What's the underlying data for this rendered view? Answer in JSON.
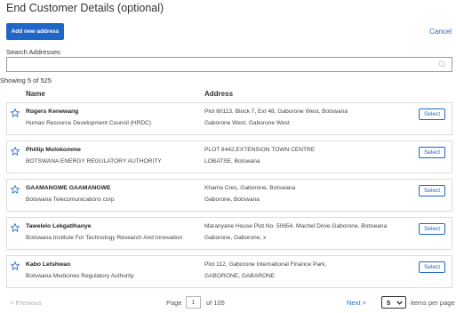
{
  "header": {
    "title": "End Customer Details (optional)",
    "add_label": "Add new address",
    "cancel_label": "Cancel"
  },
  "search": {
    "label": "Search Addresses",
    "value": "",
    "placeholder": ""
  },
  "showing_text": "Showing 5 of 525",
  "columns": {
    "name": "Name",
    "address": "Address"
  },
  "rows": [
    {
      "name": "Rogers Kenewang",
      "org": "Human Resource Development Council (HRDC)",
      "addr1": "Plot 60113, Block 7, Ext 48, Gaborone West, Botswana",
      "addr2": "Gaborone West, Gaborone West",
      "select": "Select"
    },
    {
      "name": "Phillip Molokomme",
      "org": "BOTSWANA ENERGY REGULATORY AUTHORITY",
      "addr1": "PLOT 8442,EXTENSION TOWN CENTRE",
      "addr2": "LOBATSE, Botswana",
      "select": "Select"
    },
    {
      "name": "GAAMANGWE GAAMANGWE",
      "org": "Botswana Telecomunications corp",
      "addr1": "Khama Cres, Gaborone, Botswana",
      "addr2": "Gaborone, Botswana",
      "select": "Select"
    },
    {
      "name": "Tawelelo Lekgatlhanye",
      "org": "Botswana Institute For Technology Research And Innovation",
      "addr1": "Maranyane House Plot No. 50654, Machel Drive Gaborone, Botswana",
      "addr2": "Gaborone, Gaborone, x",
      "select": "Select"
    },
    {
      "name": "Kabo Letshwao",
      "org": "Botswana Medicines Regulatory Authority",
      "addr1": "Plot 112, Gaborone International Finance Park,",
      "addr2": "GABORONE, GABARONE",
      "select": "Select"
    }
  ],
  "pagination": {
    "previous": "< Previous",
    "page_label": "Page",
    "current_page": "1",
    "of_total": "of 105",
    "next": "Next >",
    "per_page_value": "5",
    "per_page_label": "items per page"
  },
  "colors": {
    "accent": "#1f66c6",
    "border": "#dcdcdc"
  },
  "icons": {
    "star": "star-outline-icon",
    "search": "search-icon",
    "dropdown": "chevron-down-icon"
  }
}
